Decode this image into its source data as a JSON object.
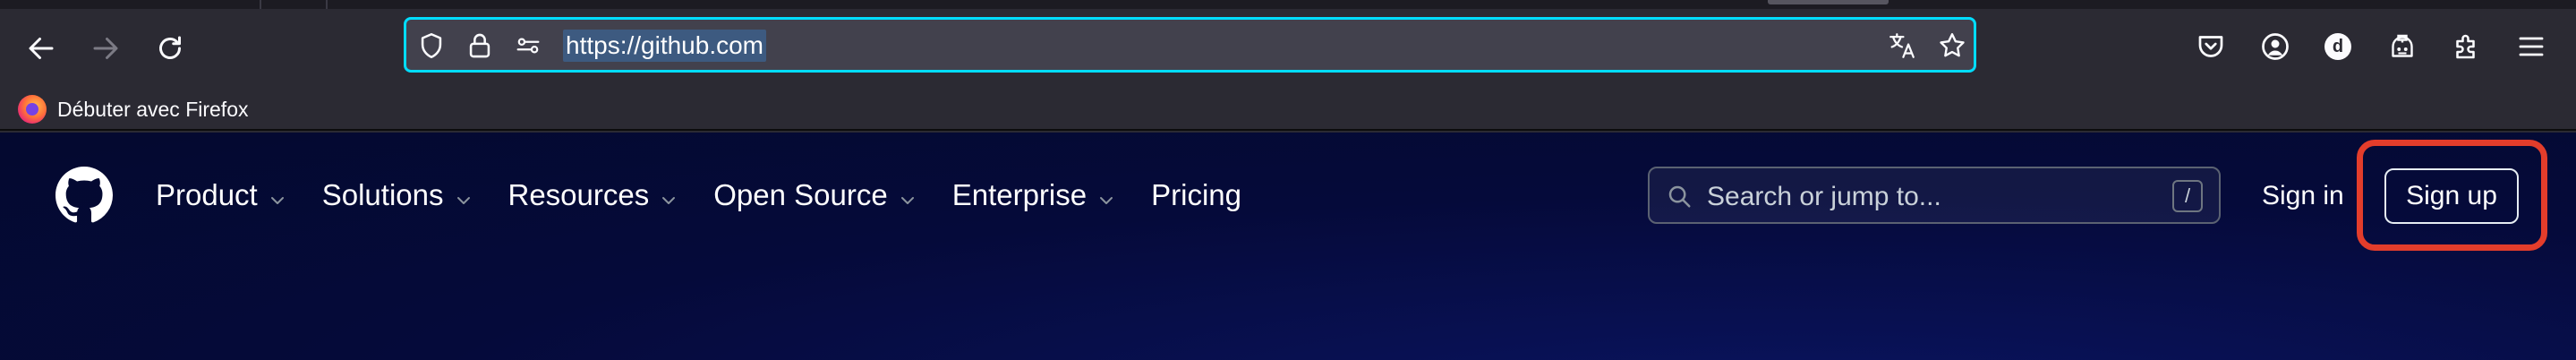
{
  "browser": {
    "url": "https://github.com",
    "bookmarks": [
      {
        "label": "Débuter avec Firefox",
        "icon": "firefox-icon"
      }
    ],
    "toolbar_icons": [
      "back-icon",
      "forward-icon",
      "reload-icon",
      "shield-icon",
      "lock-icon",
      "permissions-icon",
      "translate-icon",
      "star-icon",
      "pocket-icon",
      "account-icon",
      "profile-avatar-icon",
      "extension-icon",
      "puzzle-icon",
      "menu-icon"
    ],
    "profile_letter": "d",
    "accent": "#00ddff"
  },
  "github": {
    "nav": [
      {
        "label": "Product",
        "has_menu": true
      },
      {
        "label": "Solutions",
        "has_menu": true
      },
      {
        "label": "Resources",
        "has_menu": true
      },
      {
        "label": "Open Source",
        "has_menu": true
      },
      {
        "label": "Enterprise",
        "has_menu": true
      },
      {
        "label": "Pricing",
        "has_menu": false
      }
    ],
    "search": {
      "placeholder": "Search or jump to...",
      "shortcut": "/"
    },
    "signin": "Sign in",
    "signup": "Sign up",
    "highlight_color": "#e33d2b",
    "background": "#050a3a"
  }
}
